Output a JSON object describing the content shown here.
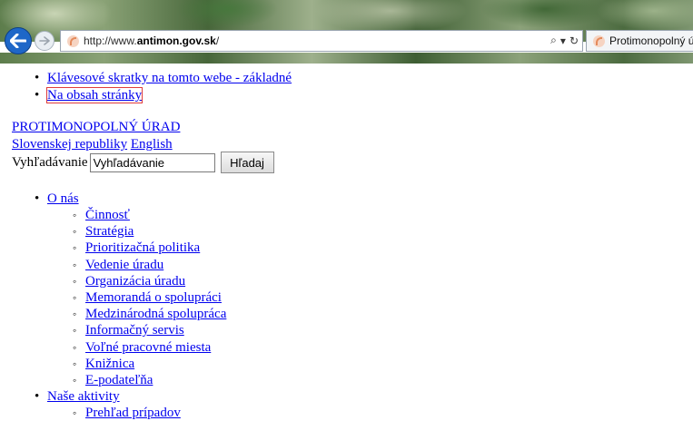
{
  "browser": {
    "url_prefix": "http://www.",
    "url_domain": "antimon.gov.sk",
    "url_suffix": "/",
    "search_icon": "⌕",
    "dropdown_icon": "▾",
    "refresh_icon": "↻",
    "tab_title": "Protimonopolný ú"
  },
  "skip_links": [
    "Klávesové skratky na tomto webe - základné",
    "Na obsah stránky"
  ],
  "brand": {
    "line1": "PROTIMONOPOLNÝ ÚRAD",
    "line2": "Slovenskej republiky",
    "english": "English"
  },
  "search": {
    "label": "Vyhľadávanie",
    "value": "Vyhľadávanie",
    "button": "Hľadaj"
  },
  "nav": {
    "o_nas": "O nás",
    "o_nas_items": [
      "Činnosť",
      "Stratégia",
      "Prioritizačná politika",
      "Vedenie úradu",
      "Organizácia úradu",
      "Memorandá o spolupráci",
      "Medzinárodná spolupráca",
      "Informačný servis",
      "Voľné pracovné miesta",
      "Knižnica",
      "E-podateľňa"
    ],
    "nase_aktivity": "Naše aktivity",
    "nase_aktivity_items": [
      "Prehľad prípadov"
    ]
  }
}
